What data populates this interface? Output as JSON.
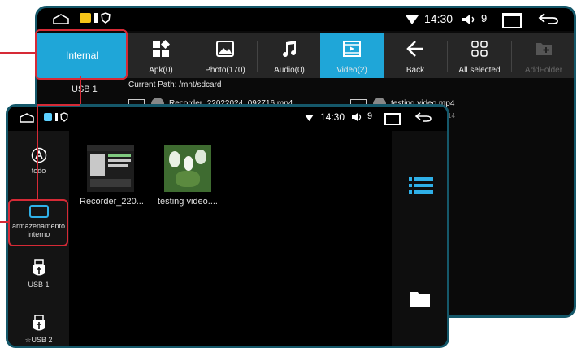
{
  "back": {
    "status": {
      "time": "14:30",
      "volume": "9"
    },
    "internal_tab": "Internal",
    "tabs": [
      {
        "label": "Apk(0)"
      },
      {
        "label": "Photo(170)"
      },
      {
        "label": "Audio(0)"
      },
      {
        "label": "Video(2)"
      },
      {
        "label": "Back"
      },
      {
        "label": "All selected"
      },
      {
        "label": "AddFolder"
      }
    ],
    "current_path": "Current Path: /mnt/sdcard",
    "usb1": "USB 1",
    "files": [
      {
        "name": "Recorder_22022024_092716.mp4"
      },
      {
        "name": "testing video.mp4"
      }
    ],
    "file_meta": "14"
  },
  "front": {
    "status": {
      "time": "14:30",
      "volume": "9"
    },
    "sidebar": [
      {
        "label": "todo"
      },
      {
        "label": "armazenamento interno"
      },
      {
        "label": "USB 1"
      },
      {
        "label": "☆USB 2"
      }
    ],
    "files": [
      {
        "name": "Recorder_220..."
      },
      {
        "name": "testing video...."
      }
    ]
  },
  "colors": {
    "accent": "#1fa6d8",
    "highlight": "#d62a36",
    "frame": "#15586a"
  }
}
